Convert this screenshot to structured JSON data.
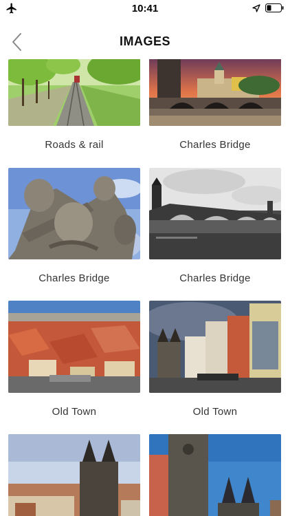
{
  "status": {
    "time": "10:41"
  },
  "nav": {
    "title": "IMAGES"
  },
  "images": [
    {
      "caption": "Roads & rail"
    },
    {
      "caption": "Charles Bridge"
    },
    {
      "caption": "Charles Bridge"
    },
    {
      "caption": "Charles Bridge"
    },
    {
      "caption": "Old Town"
    },
    {
      "caption": "Old Town"
    },
    {
      "caption": ""
    },
    {
      "caption": ""
    }
  ]
}
